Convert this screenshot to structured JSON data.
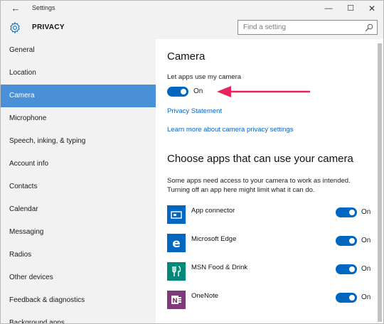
{
  "window": {
    "title": "Settings",
    "back_icon": "back-arrow-icon",
    "controls": {
      "minimize": "—",
      "maximize": "☐",
      "close": "✕"
    }
  },
  "header": {
    "icon": "gear-icon",
    "title": "PRIVACY",
    "search_placeholder": "Find a setting"
  },
  "sidebar": {
    "items": [
      {
        "label": "General"
      },
      {
        "label": "Location"
      },
      {
        "label": "Camera",
        "active": true
      },
      {
        "label": "Microphone"
      },
      {
        "label": "Speech, inking, & typing"
      },
      {
        "label": "Account info"
      },
      {
        "label": "Contacts"
      },
      {
        "label": "Calendar"
      },
      {
        "label": "Messaging"
      },
      {
        "label": "Radios"
      },
      {
        "label": "Other devices"
      },
      {
        "label": "Feedback & diagnostics"
      },
      {
        "label": "Background apps"
      }
    ]
  },
  "main": {
    "heading": "Camera",
    "toggle_label": "Let apps use my camera",
    "toggle_state": "On",
    "privacy_link": "Privacy Statement",
    "learn_link": "Learn more about camera privacy settings",
    "apps_heading": "Choose apps that can use your camera",
    "apps_desc": "Some apps need access to your camera to work as intended. Turning off an app here might limit what it can do.",
    "apps": [
      {
        "name": "App connector",
        "state": "On",
        "color": "#0067c0",
        "icon": "app-connector-icon"
      },
      {
        "name": "Microsoft Edge",
        "state": "On",
        "color": "#0067c0",
        "icon": "edge-icon"
      },
      {
        "name": "MSN Food & Drink",
        "state": "On",
        "color": "#00897b",
        "icon": "food-drink-icon"
      },
      {
        "name": "OneNote",
        "state": "On",
        "color": "#80397b",
        "icon": "onenote-icon"
      }
    ]
  },
  "colors": {
    "accent": "#0067c0",
    "sidebar_active": "#4a90d9",
    "link": "#0a63c9",
    "annotation_arrow": "#e8245c"
  }
}
